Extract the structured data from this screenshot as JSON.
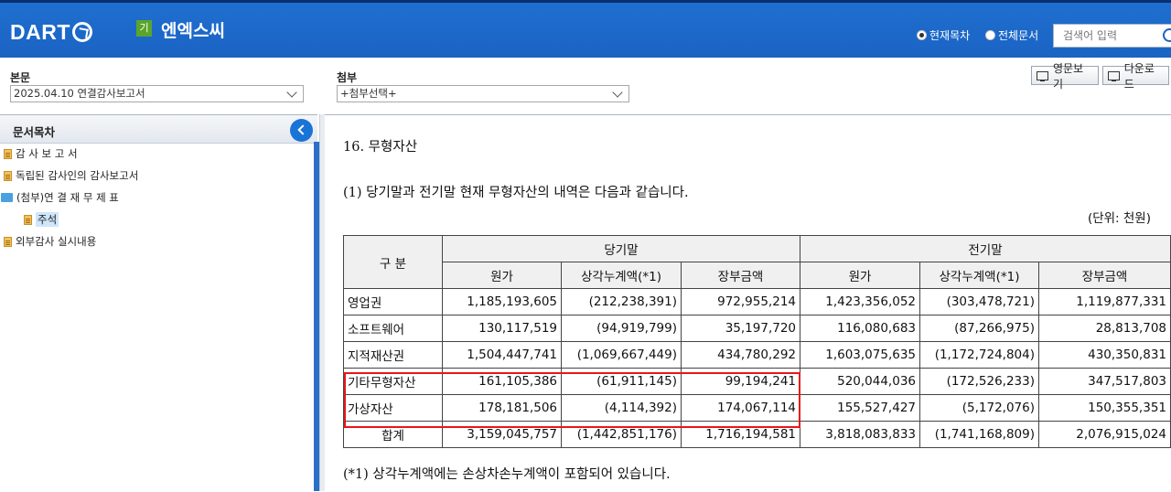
{
  "header": {
    "logo_text": "DART",
    "corp_badge": "기",
    "corp_name": "엔엑스씨",
    "scope_options": [
      {
        "label": "현재목차",
        "selected": true
      },
      {
        "label": "전체문서",
        "selected": false
      }
    ],
    "search_placeholder": "검색어 입력"
  },
  "selectors": {
    "main_label": "본문",
    "main_value": "2025.04.10  연결감사보고서",
    "attach_label": "첨부",
    "attach_value": "+첨부선택+",
    "english_button": "영문보기",
    "download_button": "다운로드"
  },
  "toc": {
    "title": "문서목차",
    "items": [
      {
        "label": "감 사 보 고 서"
      },
      {
        "label": "독립된 감사인의 감사보고서"
      },
      {
        "label": "(첨부)연 결 재 무 제 표"
      },
      {
        "label": "주석"
      },
      {
        "label": "외부감사 실시내용"
      }
    ]
  },
  "content": {
    "section_title": "16. 무형자산",
    "paragraph": "(1) 당기말과 전기말 현재 무형자산의 내역은 다음과 같습니다.",
    "unit": "(단위: 천원)",
    "table": {
      "row_header": "구 분",
      "groups": [
        "당기말",
        "전기말"
      ],
      "columns": [
        "원가",
        "상각누계액(*1)",
        "장부금액",
        "원가",
        "상각누계액(*1)",
        "장부금액"
      ],
      "rows": [
        {
          "label": "영업권",
          "values": [
            "1,185,193,605",
            "(212,238,391)",
            "972,955,214",
            "1,423,356,052",
            "(303,478,721)",
            "1,119,877,331"
          ]
        },
        {
          "label": "소프트웨어",
          "values": [
            "130,117,519",
            "(94,919,799)",
            "35,197,720",
            "116,080,683",
            "(87,266,975)",
            "28,813,708"
          ]
        },
        {
          "label": "지적재산권",
          "values": [
            "1,504,447,741",
            "(1,069,667,449)",
            "434,780,292",
            "1,603,075,635",
            "(1,172,724,804)",
            "430,350,831"
          ]
        },
        {
          "label": "기타무형자산",
          "values": [
            "161,105,386",
            "(61,911,145)",
            "99,194,241",
            "520,044,036",
            "(172,526,233)",
            "347,517,803"
          ]
        },
        {
          "label": "가상자산",
          "values": [
            "178,181,506",
            "(4,114,392)",
            "174,067,114",
            "155,527,427",
            "(5,172,076)",
            "150,355,351"
          ]
        }
      ],
      "total": {
        "label": "합계",
        "values": [
          "3,159,045,757",
          "(1,442,851,176)",
          "1,716,194,581",
          "3,818,083,833",
          "(1,741,168,809)",
          "2,076,915,024"
        ]
      }
    },
    "footnote": "(*1) 상각누계액에는 손상차손누계액이 포함되어 있습니다.",
    "highlight_color": "#e8161a"
  }
}
